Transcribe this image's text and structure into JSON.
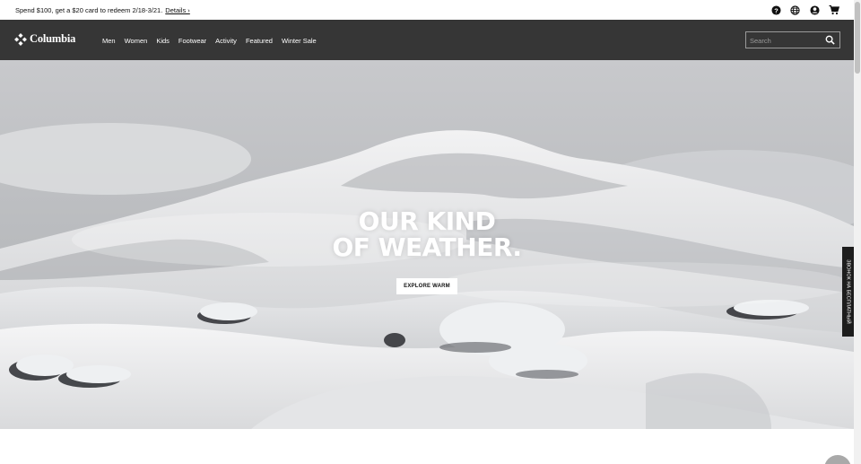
{
  "promo": {
    "text": "Spend $100, get a $20 card to redeem 2/18-3/21.",
    "details_label": "Details ›"
  },
  "utility": {
    "help_icon": "help-circle-icon",
    "globe_icon": "globe-icon",
    "account_icon": "account-icon",
    "cart_icon": "cart-icon"
  },
  "header": {
    "logo_text": "Columbia",
    "nav": [
      "Men",
      "Women",
      "Kids",
      "Footwear",
      "Activity",
      "Featured",
      "Winter Sale"
    ],
    "search_placeholder": "Search"
  },
  "hero": {
    "title_line1": "OUR KIND",
    "title_line2": "OF WEATHER.",
    "cta_label": "EXPLORE WARM"
  },
  "feedback_tab": {
    "label": "ЗВОНОК НА БЕСПЛАТНЫЙ"
  },
  "colors": {
    "header_bg": "#363636",
    "hero_text": "#ffffff",
    "cta_bg": "#ffffff"
  }
}
